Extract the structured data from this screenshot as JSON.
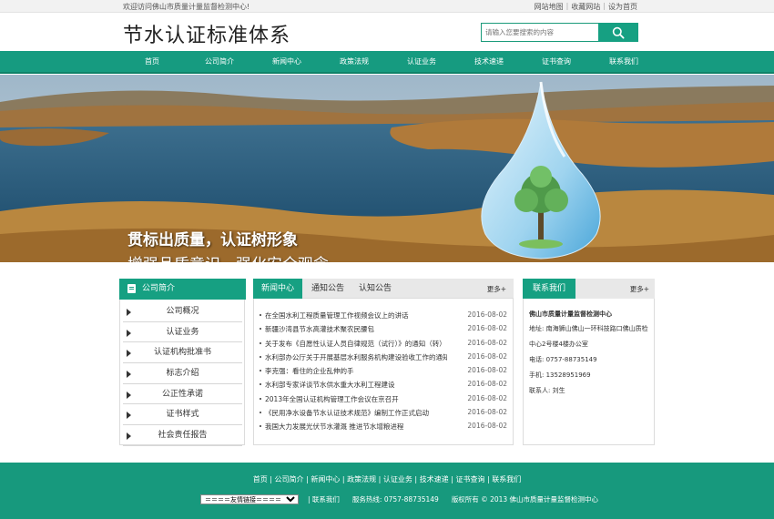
{
  "topbar": {
    "welcome": "欢迎访问佛山市质量计量监督检测中心!",
    "links": [
      "网站地图",
      "收藏网站",
      "设为首页"
    ],
    "sep": "|"
  },
  "header": {
    "title": "节水认证标准体系",
    "search_placeholder": "请输入您要搜索的内容"
  },
  "nav": [
    "首页",
    "公司简介",
    "新闻中心",
    "政策法规",
    "认证业务",
    "技术速递",
    "证书查询",
    "联系我们"
  ],
  "banner": {
    "slogan1": "贯标出质量，认证树形象",
    "slogan2": "增强品质意识，强化安全观念"
  },
  "sidebar": {
    "title": "公司简介",
    "items": [
      "公司概况",
      "认证业务",
      "认证机构批准书",
      "标志介绍",
      "公正性承诺",
      "证书样式",
      "社会责任报告"
    ]
  },
  "news": {
    "tabs": [
      "新闻中心",
      "通知公告",
      "认知公告"
    ],
    "more": "更多+",
    "items": [
      {
        "title": "在全国水利工程质量管理工作视频会议上的讲话",
        "date": "2016-08-02"
      },
      {
        "title": "新疆沙湾县节水高灌技术聚农民腰包",
        "date": "2016-08-02"
      },
      {
        "title": "关于发布《自愿性认证人员自律规范（试行）》的通知（转）",
        "date": "2016-08-02"
      },
      {
        "title": "水利部办公厅关于开展基层水利服务机构建设验收工作的通知（...",
        "date": "2016-08-02"
      },
      {
        "title": "李克强：看住的企业乱伸的手",
        "date": "2016-08-02"
      },
      {
        "title": "水利部专家详谈节水供水重大水利工程建设",
        "date": "2016-08-02"
      },
      {
        "title": "2013年全国认证机构管理工作会议在京召开",
        "date": "2016-08-02"
      },
      {
        "title": "《民用净水设备节水认证技术规范》编制工作正式启动",
        "date": "2016-08-02"
      },
      {
        "title": "我国大力发展光伏节水灌溉 推进节水增粮进程",
        "date": "2016-08-02"
      }
    ]
  },
  "contact": {
    "title": "联系我们",
    "more": "更多+",
    "org": "佛山市质量计量监督检测中心",
    "address": "地址: 南海狮山佛山一环科技路口佛山质检中心2号楼4楼办公室",
    "phone": "电话: 0757-88735149",
    "mobile": "手机: 13528951969",
    "person": "联系人: 刘生"
  },
  "footer": {
    "links": "首页 | 公司简介 | 新闻中心 | 政策法规 | 认证业务 | 技术速递 | 证书查询 | 联系我们",
    "select_label": "＝＝＝＝友情链接＝＝＝＝",
    "contact_link": "| 联系我们",
    "hotline": "服务热线: 0757-88735149",
    "copyright": "版权所有 © 2013 佛山市质量计量监督检测中心"
  },
  "colors": {
    "brand_green": "#16a082",
    "footer_green": "#17997d"
  }
}
